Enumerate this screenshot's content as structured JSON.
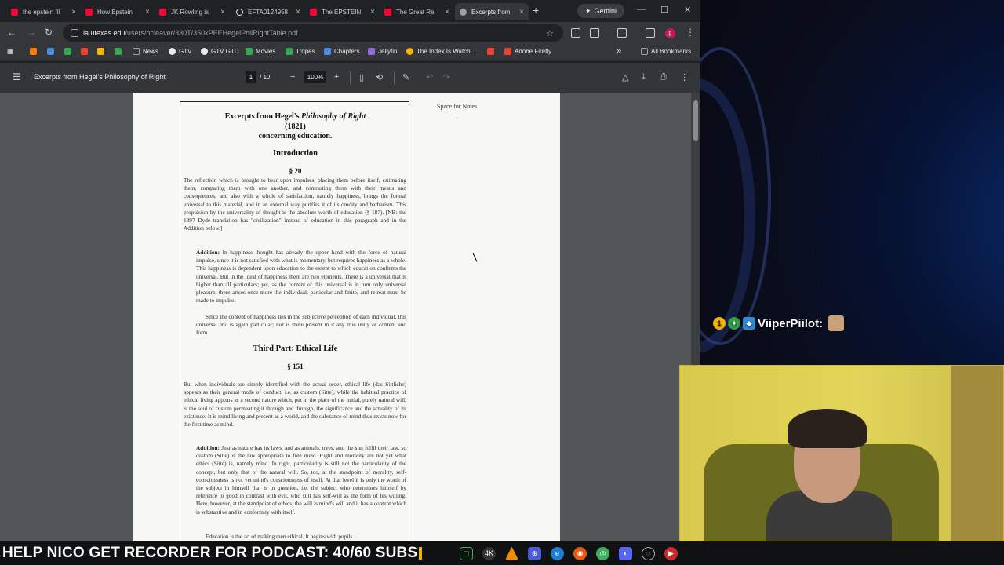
{
  "tabs": [
    {
      "title": "the epstein fil",
      "color": "#ff0033"
    },
    {
      "title": "How Epstein",
      "color": "#ff0033"
    },
    {
      "title": "JK Rowling is",
      "color": "#ff0033"
    },
    {
      "title": "EFTA0124958",
      "color": "#e8eaed"
    },
    {
      "title": "The EPSTEIN",
      "color": "#ff0033"
    },
    {
      "title": "The Great Re",
      "color": "#ff0033"
    },
    {
      "title": "Excerpts from",
      "color": "#9aa0a6"
    }
  ],
  "tabbar": {
    "new_tab": "+",
    "gemini": "Gemini"
  },
  "address": {
    "host": "la.utexas.edu",
    "path": "/users/hcleaver/330T/350kPEEHegelPhilRightTable.pdf"
  },
  "profile_initial": "g",
  "bookmarks": [
    {
      "label": "",
      "color": "#ff7a00"
    },
    {
      "label": "",
      "color": "#4a89dc"
    },
    {
      "label": "",
      "color": "#34a853"
    },
    {
      "label": "",
      "color": "#ea4335"
    },
    {
      "label": "",
      "color": "#f4b400"
    },
    {
      "label": "",
      "color": "#34a853"
    },
    {
      "label": "News",
      "color": "#9aa0a6"
    },
    {
      "label": "GTV",
      "color": "#e8eaed"
    },
    {
      "label": "GTV GTD",
      "color": "#e8eaed"
    },
    {
      "label": "Movies",
      "color": "#34a853"
    },
    {
      "label": "Tropes",
      "color": "#34a853"
    },
    {
      "label": "Chapters",
      "color": "#4a89dc"
    },
    {
      "label": "Jellyfin",
      "color": "#8e6bd8"
    },
    {
      "label": "The Index Is Watchi...",
      "color": "#f4b400"
    },
    {
      "label": "",
      "color": "#ea4335"
    },
    {
      "label": "Adobe Firefly",
      "color": "#ea4335"
    }
  ],
  "bookmarks_more": "»",
  "all_bookmarks": "All Bookmarks",
  "pdf": {
    "title": "Excerpts from Hegel's Philosophy of Right",
    "page_current": "1",
    "page_total": "/ 10",
    "zoom": "100%"
  },
  "doc": {
    "title_pre": "Excerpts from Hegel's ",
    "title_italic": "Philosophy of Right",
    "year": "(1821)",
    "concerning": "concerning education.",
    "intro": "Introduction",
    "sec20": "§ 20",
    "p1": "The reflection which is brought to bear upon impulses, placing them before itself, estimating them, comparing them with one another, and contrasting them with their means and consequences, and also with a whole of satisfaction, namely happiness, brings the formal universal to this material, and in an external way purifies it of its crudity and barbarism. This propulsion by the universality of thought is the absolute worth of education (§ 187). [NB: the 1897 Dyde translation has \"civilization\" instead of education in this paragraph and in the Addition below.]",
    "add1_label": "Addition:",
    "add1": " In happiness thought has already the upper hand with the force of natural impulse, since it is not satisfied with what is momentary, but requires happiness as a whole. This happiness is dependent upon education to the extent to which education confirms the universal. But in the ideal of happiness there are two elements. There is a universal that is higher than all particulars; yet, as the content of this universal is in turn only universal pleasure, there arises once more the individual, particular and finite, and retreat must be made to impulse.",
    "add1b": "Since the content of happiness lies in the subjective perception of each individual, this universal end is again particular; nor is there present in it any true unity of content and form",
    "part3": "Third Part: Ethical Life",
    "sec151": "§ 151",
    "p2": "But when individuals are simply identified with the actual order, ethical life (das Sittliche) appears as their general mode of conduct, i.e. as custom (Sitte), while the habitual practice of ethical living appears as a second nature which, put in the place of the initial, purely natural will, is the soul of custom permeating it through and through, the significance and the actuality of its existence. It is mind living and present as a world, and the substance of mind thus exists now for the first time as mind.",
    "add2_label": "Addition:",
    "add2": " Just as nature has its laws, and as animals, trees, and the sun fulfil their law, so custom (Sitte) is the law appropriate to free mind. Right and morality are not yet what ethics (Sitte) is, namely mind. In right, particularity is still not the particularity of the concept, but only that of the natural will. So, too, at the standpoint of morality, self-consciousness is not yet mind's consciousness of itself. At that level it is only the worth of the subject in himself that is in question, i.e. the subject who determines himself by reference to good in contrast with evil, who still has self-will as the form of his willing. Here, however, at the standpoint of ethics, the will is mind's will and it has a content which is substantive and in conformity with itself.",
    "add2b": "Education is the art of making men ethical. It begins with pupils",
    "notes": "Space for Notes",
    "notes_arrow": "↓"
  },
  "chat": {
    "user": "ViiperPiilot:",
    "badge_num": "1"
  },
  "ticker": "HELP NICO GET RECORDER FOR PODCAST: 40/60 SUBS"
}
